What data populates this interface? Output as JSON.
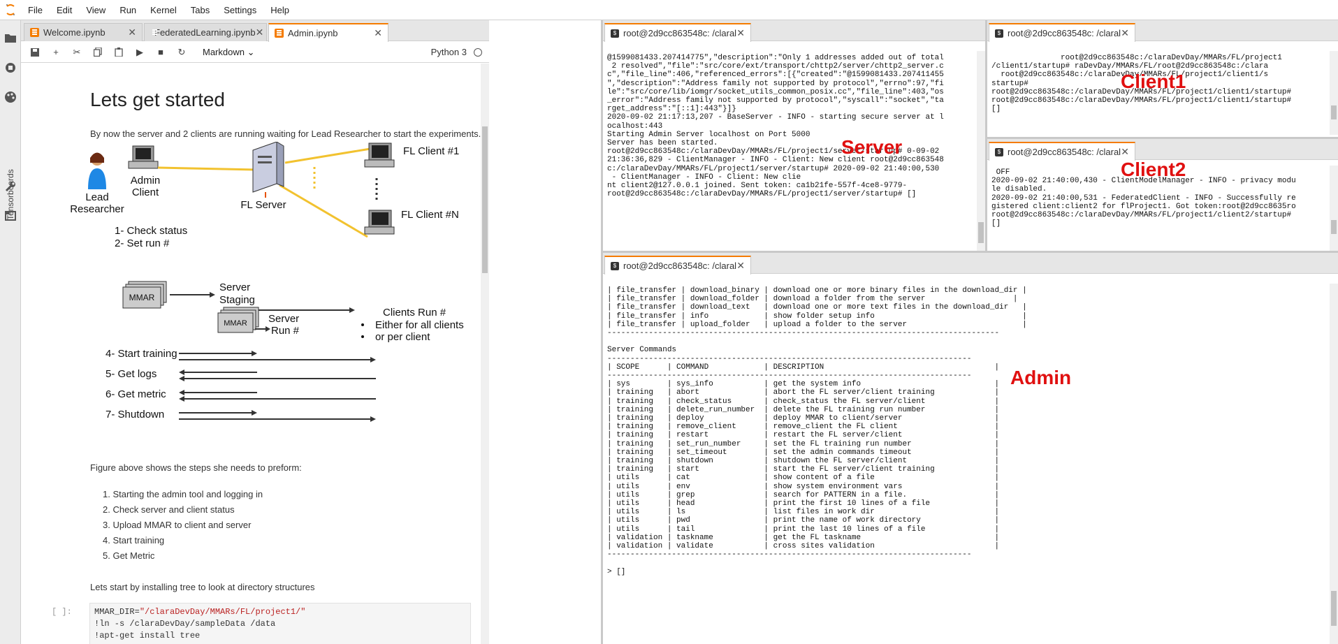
{
  "menu": {
    "items": [
      "File",
      "Edit",
      "View",
      "Run",
      "Kernel",
      "Tabs",
      "Settings",
      "Help"
    ]
  },
  "sidebar": {
    "icons": [
      "folder-icon",
      "running-icon",
      "palette-icon",
      "tensorboard-icon",
      "wrench-icon",
      "tabs-icon"
    ],
    "vertical_label": "Tensorboards"
  },
  "notebook_tabs": [
    {
      "label": "Welcome.ipynb"
    },
    {
      "label": "FederatedLearning.ipynb"
    },
    {
      "label": "Admin.ipynb"
    }
  ],
  "toolbar": {
    "cell_type": "Markdown",
    "kernel": "Python 3"
  },
  "notebook": {
    "heading": "Lets get started",
    "intro": "By now the server and 2 clients are running waiting for Lead Researcher to start the experiments.",
    "figure_caption": "Figure above shows the steps she needs to preform:",
    "steps": [
      "1. Starting the admin tool and logging in",
      "2. Check server and client status",
      "3. Upload MMAR to client and server",
      "4. Start training",
      "5. Get Metric"
    ],
    "tree_text": "Lets start by installing tree to look at directory structures",
    "prompt": "[ ]:",
    "code": {
      "line1_var": "MMAR_DIR=",
      "line1_str": "\"/claraDevDay/MMARs/FL/project1/\"",
      "line2": "!ln -s /claraDevDay/sampleData /data",
      "line3": "!apt-get install tree"
    }
  },
  "diagram": {
    "lead": [
      "Lead",
      "Researcher"
    ],
    "admin": [
      "Admin",
      "Client"
    ],
    "server": "FL Server",
    "client1": "FL Client #1",
    "clientn": "FL Client #N",
    "check": "1- Check status",
    "setrun": "2- Set run #",
    "mmar": "MMAR",
    "server_staging": [
      "Server",
      "Staging"
    ],
    "server_run": [
      "Server",
      "Run #"
    ],
    "clients_run": "Clients Run #",
    "either": "Either for all clients",
    "per_client": "or per client",
    "start_training": "4- Start training",
    "get_logs": "5- Get logs",
    "get_metric": "6- Get metric",
    "shutdown": "7- Shutdown"
  },
  "terminals": {
    "server": {
      "tab": "root@2d9cc863548c: /claral",
      "label": "Server",
      "lines": [
        "@1599081433.207414775\",\"description\":\"Only 1 addresses added out of total",
        " 2 resolved\",\"file\":\"src/core/ext/transport/chttp2/server/chttp2_server.c",
        "c\",\"file_line\":406,\"referenced_errors\":[{\"created\":\"@1599081433.207411455",
        "\",\"description\":\"Address family not supported by protocol\",\"errno\":97,\"fi",
        "le\":\"src/core/lib/iomgr/socket_utils_common_posix.cc\",\"file_line\":403,\"os",
        "_error\":\"Address family not supported by protocol\",\"syscall\":\"socket\",\"ta",
        "rget_address\":\"[::1]:443\"}]}",
        "2020-09-02 21:17:13,207 - BaseServer - INFO - starting secure server at l",
        "ocalhost:443",
        "Starting Admin Server localhost on Port 5000",
        "Server has been started.",
        "root@2d9cc863548c:/claraDevDay/MMARs/FL/project1/server/startup# 0-09-02",
        "21:36:36,829 - ClientManager - INFO - Client: New client root@2d9cc863548",
        "c:/claraDevDay/MMARs/FL/project1/server/startup# 2020-09-02 21:40:00,530",
        " - ClientManager - INFO - Client: New clie",
        "nt client2@127.0.0.1 joined. Sent token: ca1b21fe-557f-4ce8-9779-",
        "root@2d9cc863548c:/claraDevDay/MMARs/FL/project1/server/startup# []"
      ]
    },
    "client1": {
      "tab": "root@2d9cc863548c: /claral",
      "label": "Client1",
      "lines": [
        "               root@2d9cc863548c:/claraDevDay/MMARs/FL/project1",
        "/client1/startup# raDevDay/MMARs/FL/root@2d9cc863548c:/clara",
        "  root@2d9cc863548c:/claraDevDay/MMARs/FL/project1/client1/s",
        "startup#",
        "root@2d9cc863548c:/claraDevDay/MMARs/FL/project1/client1/startup#",
        "root@2d9cc863548c:/claraDevDay/MMARs/FL/project1/client1/startup#",
        "[]"
      ]
    },
    "client2": {
      "tab": "root@2d9cc863548c: /claral",
      "label": "Client2",
      "lines": [
        " OFF",
        "2020-09-02 21:40:00,430 - ClientModelManager - INFO - privacy modu",
        "le disabled.",
        "2020-09-02 21:40:00,531 - FederatedClient - INFO - Successfully re",
        "gistered client:client2 for flProject1. Got token:root@2d9cc8635ro",
        "root@2d9cc863548c:/claraDevDay/MMARs/FL/project1/client2/startup#",
        "[]"
      ]
    },
    "admin": {
      "tab": "root@2d9cc863548c: /claral",
      "label": "Admin",
      "lines": [
        "| file_transfer | download_binary | download one or more binary files in the download_dir |",
        "| file_transfer | download_folder | download a folder from the server                   |",
        "| file_transfer | download_text   | download one or more text files in the download_dir   |",
        "| file_transfer | info            | show folder setup info                                |",
        "| file_transfer | upload_folder   | upload a folder to the server                         |",
        "-------------------------------------------------------------------------------------",
        "",
        "Server Commands",
        "-------------------------------------------------------------------------------",
        "| SCOPE      | COMMAND            | DESCRIPTION                                     |",
        "-------------------------------------------------------------------------------",
        "| sys        | sys_info           | get the system info                             |",
        "| training   | abort              | abort the FL server/client training             |",
        "| training   | check_status       | check_status the FL server/client               |",
        "| training   | delete_run_number  | delete the FL training run number               |",
        "| training   | deploy             | deploy MMAR to client/server                    |",
        "| training   | remove_client      | remove_client the FL client                     |",
        "| training   | restart            | restart the FL server/client                    |",
        "| training   | set_run_number     | set the FL training run number                  |",
        "| training   | set_timeout        | set the admin commands timeout                  |",
        "| training   | shutdown           | shutdown the FL server/client                   |",
        "| training   | start              | start the FL server/client training             |",
        "| utils      | cat                | show content of a file                          |",
        "| utils      | env                | show system environment vars                    |",
        "| utils      | grep               | search for PATTERN in a file.                   |",
        "| utils      | head               | print the first 10 lines of a file              |",
        "| utils      | ls                 | list files in work dir                          |",
        "| utils      | pwd                | print the name of work directory                |",
        "| utils      | tail               | print the last 10 lines of a file               |",
        "| validation | taskname           | get the FL taskname                             |",
        "| validation | validate           | cross sites validation                          |",
        "-------------------------------------------------------------------------------",
        "",
        "> []"
      ]
    }
  }
}
